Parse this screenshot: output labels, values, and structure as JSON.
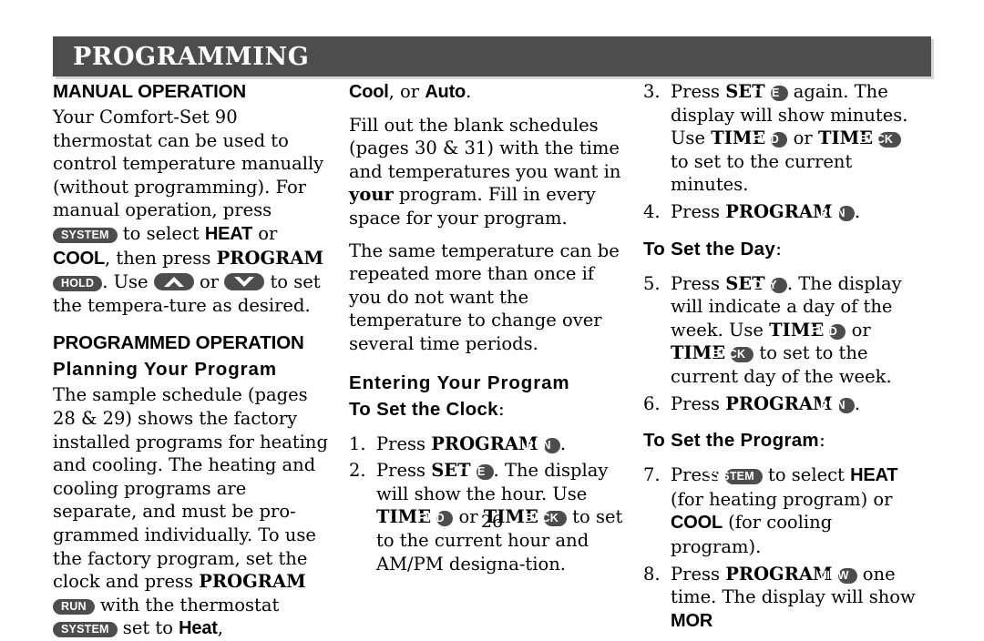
{
  "banner": {
    "title": "PROGRAMMING",
    "bg_color": "#4d4d4d",
    "text_color": "#ffffff"
  },
  "pill_color": "#4d4d4d",
  "page_number": "26",
  "column1": {
    "heading_manual": "MANUAL OPERATION",
    "para1_a": "Your Comfort-Set 90 thermostat can be used to control temperature manually (without programming). For manual operation, press ",
    "pill_system": "SYSTEM",
    "para1_b": " to select ",
    "heat": "HEAT",
    "para1_c": " or ",
    "cool": "COOL",
    "para1_d": ", then press ",
    "program": "PROGRAM",
    "pill_hold": "HOLD",
    "para1_e": ". Use ",
    "arrow_up": "chevron-up",
    "para1_f": " or ",
    "arrow_down": "chevron-down",
    "para1_g": " to set the tempera-ture as desired.",
    "heading_programmed": "PROGRAMMED OPERATION",
    "heading_planning": "Planning Your Program",
    "para2_a": "The sample schedule (pages 28 & 29) shows the factory installed programs for heating and cooling. The heating and cooling programs are separate, and must be pro-grammed individually. To use the factory program, set the clock and press ",
    "para2_program": "PROGRAM",
    "pill_run": "RUN",
    "para2_b": " with the thermostat ",
    "pill_system2": "SYSTEM",
    "para2_c": " set to ",
    "heat_word": "Heat",
    "para2_d": ","
  },
  "column2": {
    "cool_word": "Cool",
    "cont_a": ", or ",
    "auto_word": "Auto",
    "cont_b": ".",
    "para1_a": "Fill out the blank schedules (pages 30 & 31) with the time and temperatures you want in ",
    "your_word": "your",
    "para1_b": " program. Fill in every space for your program.",
    "para2": "The same temperature can be repeated more than once if you do not want the temperature to change over several time periods.",
    "heading_entering": "Entering Your Program",
    "heading_clock": "To Set the Clock",
    "heading_clock_colon": ":",
    "step1_num": "1.",
    "step1_a": "Press ",
    "step1_program": "PROGRAM",
    "step1_pill": "RUN",
    "step1_b": ".",
    "step2_num": "2.",
    "step2_a": "Press ",
    "step2_set": "SET",
    "step2_pill_time": "TIME",
    "step2_b": ". The display will show the hour. Use ",
    "step2_time1": "TIME",
    "step2_pill_fwd": "FWD",
    "step2_c": " or ",
    "step2_time2": "TIME",
    "step2_pill_back": "BACK",
    "step2_d": " to set to the current hour and AM/PM designa-tion."
  },
  "column3": {
    "step3_num": "3.",
    "step3_a": "Press ",
    "step3_set": "SET",
    "step3_pill_time": "TIME",
    "step3_b": " again. The display will show minutes. Use ",
    "step3_time1": "TIME",
    "step3_pill_fwd": "FWD",
    "step3_c": " or ",
    "step3_time2": "TIME",
    "step3_pill_back": "BACK",
    "step3_d": " to set to the current minutes.",
    "step4_num": "4.",
    "step4_a": "Press ",
    "step4_program": "PROGRAM",
    "step4_pill": "RUN",
    "step4_b": ".",
    "heading_day": "To Set the Day",
    "heading_day_colon": ":",
    "step5_num": "5.",
    "step5_a": "Press ",
    "step5_set": "SET",
    "step5_pill_day": "DAY",
    "step5_b": ". The display will indicate a day of the week. Use ",
    "step5_time1": "TIME",
    "step5_pill_fwd": "FWD",
    "step5_c": " or ",
    "step5_time2": "TIME",
    "step5_pill_back": "BACK",
    "step5_d": " to set to the current day of the week.",
    "step6_num": "6.",
    "step6_a": "Press ",
    "step6_program": "PROGRAM",
    "step6_pill": "RUN",
    "step6_b": ".",
    "heading_program": "To Set the Program",
    "heading_program_colon": ":",
    "step7_num": "7.",
    "step7_a": "Press ",
    "step7_pill_system": "SYSTEM",
    "step7_b": " to select ",
    "step7_heat": "HEAT",
    "step7_c": " (for heating program) or ",
    "step7_cool": "COOL",
    "step7_d": " (for cooling program).",
    "step8_num": "8.",
    "step8_a": "Press ",
    "step8_program": "PROGRAM",
    "step8_pill_view": "VIEW",
    "step8_b": " one time. The display will show ",
    "step8_mor": "MOR"
  }
}
